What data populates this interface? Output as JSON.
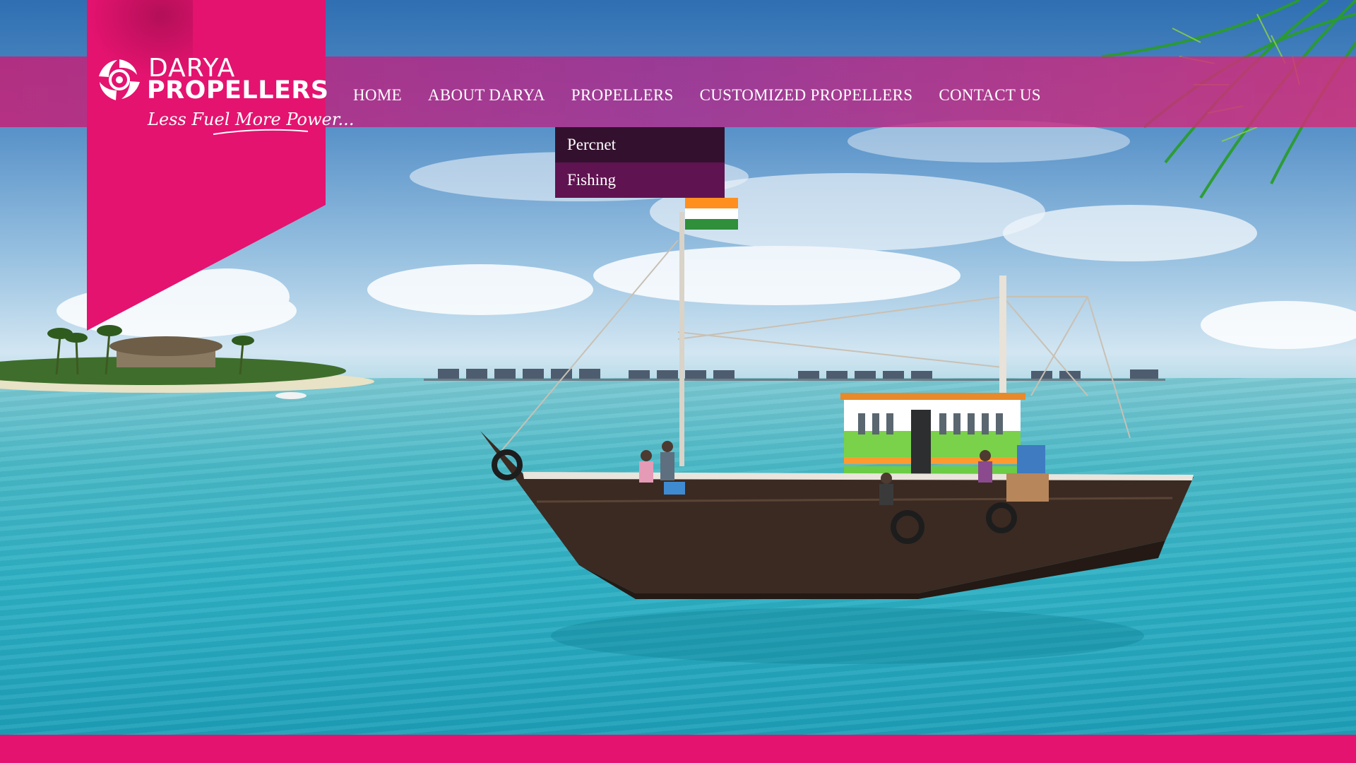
{
  "brand": {
    "name_line1": "DARYA",
    "name_line2": "PROPELLERS",
    "tagline": "Less Fuel More Power..."
  },
  "nav": {
    "items": [
      {
        "label": "HOME"
      },
      {
        "label": "ABOUT DARYA"
      },
      {
        "label": "PROPELLERS"
      },
      {
        "label": "CUSTOMIZED PROPELLERS"
      },
      {
        "label": "CONTACT US"
      }
    ]
  },
  "dropdown": {
    "items": [
      {
        "label": "Percnet",
        "state": "hover"
      },
      {
        "label": "Fishing",
        "state": "normal"
      }
    ]
  },
  "colors": {
    "brand_pink": "#e4136f",
    "dropdown_hover": "#33112e",
    "dropdown_normal": "#601351"
  }
}
